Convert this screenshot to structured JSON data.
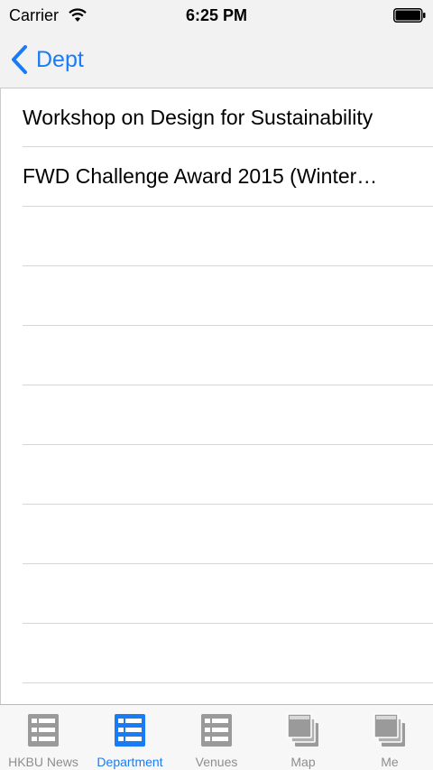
{
  "status_bar": {
    "carrier": "Carrier",
    "time": "6:25 PM"
  },
  "nav": {
    "back_label": "Dept"
  },
  "list": {
    "items": [
      "Workshop on Design for Sustainability",
      "FWD Challenge Award 2015 (Winter…"
    ]
  },
  "tabbar": {
    "tabs": [
      {
        "label": "HKBU News",
        "icon": "list-icon"
      },
      {
        "label": "Department",
        "icon": "list-icon"
      },
      {
        "label": "Venues",
        "icon": "list-icon"
      },
      {
        "label": "Map",
        "icon": "stacked-windows-icon"
      },
      {
        "label": "Me",
        "icon": "stacked-windows-icon"
      }
    ],
    "active_index": 1
  },
  "colors": {
    "accent": "#1a7cf5",
    "inactive": "#8e8e8e",
    "bar_background": "#f2f2f2"
  }
}
